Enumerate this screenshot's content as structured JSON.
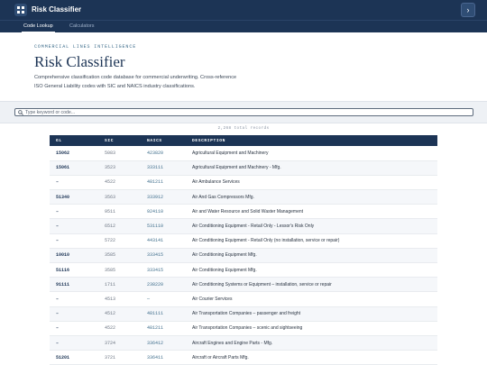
{
  "app": {
    "title": "Risk Classifier",
    "expand_icon": "chevron-right-icon",
    "app_icon": "grid-icon"
  },
  "tabs": [
    {
      "label": "Code Lookup",
      "active": true
    },
    {
      "label": "Calculators",
      "active": false
    }
  ],
  "header": {
    "eyebrow": "COMMERCIAL LINES INTELLIGENCE",
    "title": "Risk Classifier",
    "subtitle": "Comprehensive classification code database for commercial underwriting. Cross-reference ISO General Liability codes with SIC and NAICS industry classifications."
  },
  "search": {
    "placeholder": "Type keyword or code...",
    "value": ""
  },
  "record_count": "2,268 total records",
  "table": {
    "columns": [
      "GL",
      "SIC",
      "NAICS",
      "DESCRIPTION"
    ],
    "rows": [
      {
        "gl": "15062",
        "sic": "5083",
        "naics": "423820",
        "desc": "Agricultural Equipment and Machinery"
      },
      {
        "gl": "15061",
        "sic": "3523",
        "naics": "333111",
        "desc": "Agricultural Equipment and Machinery - Mfg."
      },
      {
        "gl": "–",
        "sic": "4522",
        "naics": "481211",
        "desc": "Air Ambulance Services"
      },
      {
        "gl": "51340",
        "sic": "3563",
        "naics": "333912",
        "desc": "Air And Gas Compressors Mfg."
      },
      {
        "gl": "–",
        "sic": "9511",
        "naics": "924110",
        "desc": "Air and Water Resource and Solid Waster Management"
      },
      {
        "gl": "–",
        "sic": "6512",
        "naics": "531110",
        "desc": "Air Conditioning Equipment - Retail Only - Lessor's Risk Only"
      },
      {
        "gl": "–",
        "sic": "5722",
        "naics": "443141",
        "desc": "Air Conditioning Equipment - Retail Only (no installation, service or repair)"
      },
      {
        "gl": "10010",
        "sic": "3585",
        "naics": "333415",
        "desc": "Air Conditioning Equipment Mfg."
      },
      {
        "gl": "51116",
        "sic": "3585",
        "naics": "333415",
        "desc": "Air Conditioning Equipment Mfg."
      },
      {
        "gl": "91111",
        "sic": "1711",
        "naics": "238220",
        "desc": "Air Conditioning Systems or Equipment – installation, service or repair"
      },
      {
        "gl": "–",
        "sic": "4513",
        "naics": "—",
        "desc": "Air Courier Services"
      },
      {
        "gl": "–",
        "sic": "4512",
        "naics": "481111",
        "desc": "Air Transportation Companies – passenger and freight"
      },
      {
        "gl": "–",
        "sic": "4522",
        "naics": "481211",
        "desc": "Air Transportation Companies – scenic and sightseeing"
      },
      {
        "gl": "–",
        "sic": "3724",
        "naics": "336412",
        "desc": "Aircraft Engines and Engine Parts - Mfg."
      },
      {
        "gl": "51201",
        "sic": "3721",
        "naics": "336411",
        "desc": "Aircraft or Aircraft Parts Mfg."
      }
    ]
  }
}
